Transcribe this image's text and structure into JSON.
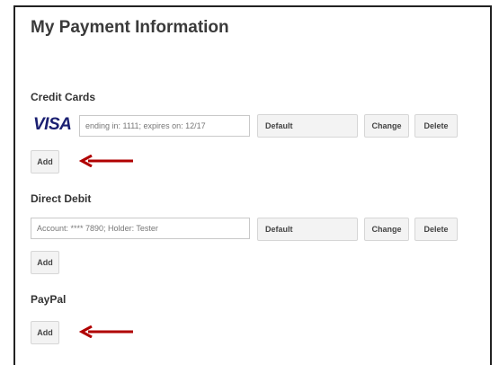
{
  "page": {
    "title": "My Payment Information"
  },
  "credit_cards": {
    "heading": "Credit Cards",
    "brand_logo": "VISA",
    "card_summary": "ending in: 1111; expires on: 12/17",
    "default_label": "Default",
    "change_label": "Change",
    "delete_label": "Delete",
    "add_label": "Add"
  },
  "direct_debit": {
    "heading": "Direct Debit",
    "account_summary": "Account: **** 7890; Holder: Tester",
    "default_label": "Default",
    "change_label": "Change",
    "delete_label": "Delete",
    "add_label": "Add"
  },
  "paypal": {
    "heading": "PayPal",
    "add_label": "Add"
  },
  "annotations": {
    "arrow_color": "#b00000"
  }
}
